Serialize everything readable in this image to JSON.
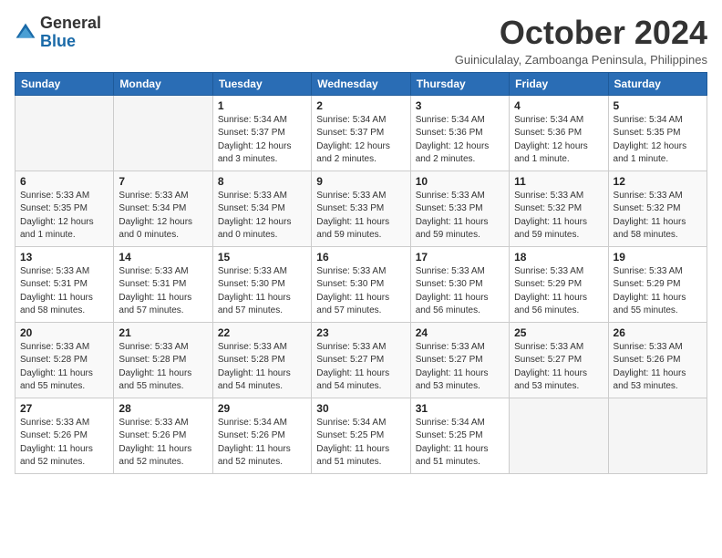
{
  "logo": {
    "general": "General",
    "blue": "Blue"
  },
  "header": {
    "month": "October 2024",
    "location": "Guiniculalay, Zamboanga Peninsula, Philippines"
  },
  "weekdays": [
    "Sunday",
    "Monday",
    "Tuesday",
    "Wednesday",
    "Thursday",
    "Friday",
    "Saturday"
  ],
  "weeks": [
    [
      {
        "day": "",
        "info": ""
      },
      {
        "day": "",
        "info": ""
      },
      {
        "day": "1",
        "info": "Sunrise: 5:34 AM\nSunset: 5:37 PM\nDaylight: 12 hours and 3 minutes."
      },
      {
        "day": "2",
        "info": "Sunrise: 5:34 AM\nSunset: 5:37 PM\nDaylight: 12 hours and 2 minutes."
      },
      {
        "day": "3",
        "info": "Sunrise: 5:34 AM\nSunset: 5:36 PM\nDaylight: 12 hours and 2 minutes."
      },
      {
        "day": "4",
        "info": "Sunrise: 5:34 AM\nSunset: 5:36 PM\nDaylight: 12 hours and 1 minute."
      },
      {
        "day": "5",
        "info": "Sunrise: 5:34 AM\nSunset: 5:35 PM\nDaylight: 12 hours and 1 minute."
      }
    ],
    [
      {
        "day": "6",
        "info": "Sunrise: 5:33 AM\nSunset: 5:35 PM\nDaylight: 12 hours and 1 minute."
      },
      {
        "day": "7",
        "info": "Sunrise: 5:33 AM\nSunset: 5:34 PM\nDaylight: 12 hours and 0 minutes."
      },
      {
        "day": "8",
        "info": "Sunrise: 5:33 AM\nSunset: 5:34 PM\nDaylight: 12 hours and 0 minutes."
      },
      {
        "day": "9",
        "info": "Sunrise: 5:33 AM\nSunset: 5:33 PM\nDaylight: 11 hours and 59 minutes."
      },
      {
        "day": "10",
        "info": "Sunrise: 5:33 AM\nSunset: 5:33 PM\nDaylight: 11 hours and 59 minutes."
      },
      {
        "day": "11",
        "info": "Sunrise: 5:33 AM\nSunset: 5:32 PM\nDaylight: 11 hours and 59 minutes."
      },
      {
        "day": "12",
        "info": "Sunrise: 5:33 AM\nSunset: 5:32 PM\nDaylight: 11 hours and 58 minutes."
      }
    ],
    [
      {
        "day": "13",
        "info": "Sunrise: 5:33 AM\nSunset: 5:31 PM\nDaylight: 11 hours and 58 minutes."
      },
      {
        "day": "14",
        "info": "Sunrise: 5:33 AM\nSunset: 5:31 PM\nDaylight: 11 hours and 57 minutes."
      },
      {
        "day": "15",
        "info": "Sunrise: 5:33 AM\nSunset: 5:30 PM\nDaylight: 11 hours and 57 minutes."
      },
      {
        "day": "16",
        "info": "Sunrise: 5:33 AM\nSunset: 5:30 PM\nDaylight: 11 hours and 57 minutes."
      },
      {
        "day": "17",
        "info": "Sunrise: 5:33 AM\nSunset: 5:30 PM\nDaylight: 11 hours and 56 minutes."
      },
      {
        "day": "18",
        "info": "Sunrise: 5:33 AM\nSunset: 5:29 PM\nDaylight: 11 hours and 56 minutes."
      },
      {
        "day": "19",
        "info": "Sunrise: 5:33 AM\nSunset: 5:29 PM\nDaylight: 11 hours and 55 minutes."
      }
    ],
    [
      {
        "day": "20",
        "info": "Sunrise: 5:33 AM\nSunset: 5:28 PM\nDaylight: 11 hours and 55 minutes."
      },
      {
        "day": "21",
        "info": "Sunrise: 5:33 AM\nSunset: 5:28 PM\nDaylight: 11 hours and 55 minutes."
      },
      {
        "day": "22",
        "info": "Sunrise: 5:33 AM\nSunset: 5:28 PM\nDaylight: 11 hours and 54 minutes."
      },
      {
        "day": "23",
        "info": "Sunrise: 5:33 AM\nSunset: 5:27 PM\nDaylight: 11 hours and 54 minutes."
      },
      {
        "day": "24",
        "info": "Sunrise: 5:33 AM\nSunset: 5:27 PM\nDaylight: 11 hours and 53 minutes."
      },
      {
        "day": "25",
        "info": "Sunrise: 5:33 AM\nSunset: 5:27 PM\nDaylight: 11 hours and 53 minutes."
      },
      {
        "day": "26",
        "info": "Sunrise: 5:33 AM\nSunset: 5:26 PM\nDaylight: 11 hours and 53 minutes."
      }
    ],
    [
      {
        "day": "27",
        "info": "Sunrise: 5:33 AM\nSunset: 5:26 PM\nDaylight: 11 hours and 52 minutes."
      },
      {
        "day": "28",
        "info": "Sunrise: 5:33 AM\nSunset: 5:26 PM\nDaylight: 11 hours and 52 minutes."
      },
      {
        "day": "29",
        "info": "Sunrise: 5:34 AM\nSunset: 5:26 PM\nDaylight: 11 hours and 52 minutes."
      },
      {
        "day": "30",
        "info": "Sunrise: 5:34 AM\nSunset: 5:25 PM\nDaylight: 11 hours and 51 minutes."
      },
      {
        "day": "31",
        "info": "Sunrise: 5:34 AM\nSunset: 5:25 PM\nDaylight: 11 hours and 51 minutes."
      },
      {
        "day": "",
        "info": ""
      },
      {
        "day": "",
        "info": ""
      }
    ]
  ]
}
